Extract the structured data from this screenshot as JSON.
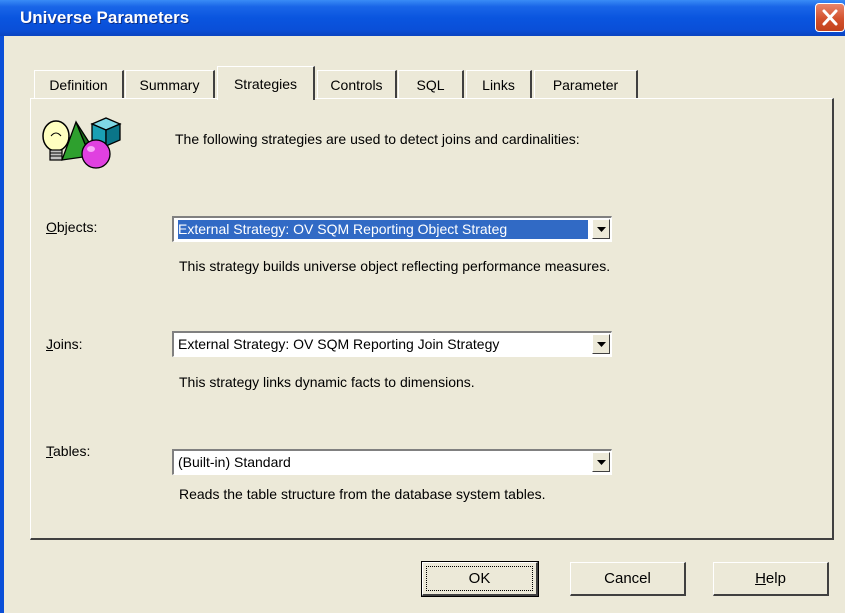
{
  "window": {
    "title": "Universe Parameters"
  },
  "tabs": [
    {
      "label": "Definition",
      "active": false
    },
    {
      "label": "Summary",
      "active": false
    },
    {
      "label": "Strategies",
      "active": true
    },
    {
      "label": "Controls",
      "active": false
    },
    {
      "label": "SQL",
      "active": false
    },
    {
      "label": "Links",
      "active": false
    },
    {
      "label": "Parameter",
      "active": false
    }
  ],
  "intro": {
    "icon": "strategy-shapes-icon",
    "text": "The following strategies are used to detect joins and cardinalities:"
  },
  "objects": {
    "label_mnemonic": "O",
    "label_rest": "bjects:",
    "value": "External Strategy: OV SQM Reporting Object Strateg",
    "description": "This strategy builds universe object reflecting performance measures."
  },
  "joins": {
    "label_mnemonic": "J",
    "label_rest": "oins:",
    "value": "External Strategy: OV SQM Reporting Join Strategy",
    "description": "This strategy links dynamic facts to dimensions."
  },
  "tables": {
    "label_mnemonic": "T",
    "label_rest": "ables:",
    "value": "(Built-in) Standard",
    "description": "Reads the table structure from the database system tables."
  },
  "buttons": {
    "ok": "OK",
    "cancel": "Cancel",
    "help_mnemonic": "H",
    "help_rest": "elp"
  },
  "colors": {
    "titlebar": "#0a55df",
    "dialog_bg": "#ece9d8",
    "selection": "#316ac5",
    "close_button": "#d3512d"
  }
}
